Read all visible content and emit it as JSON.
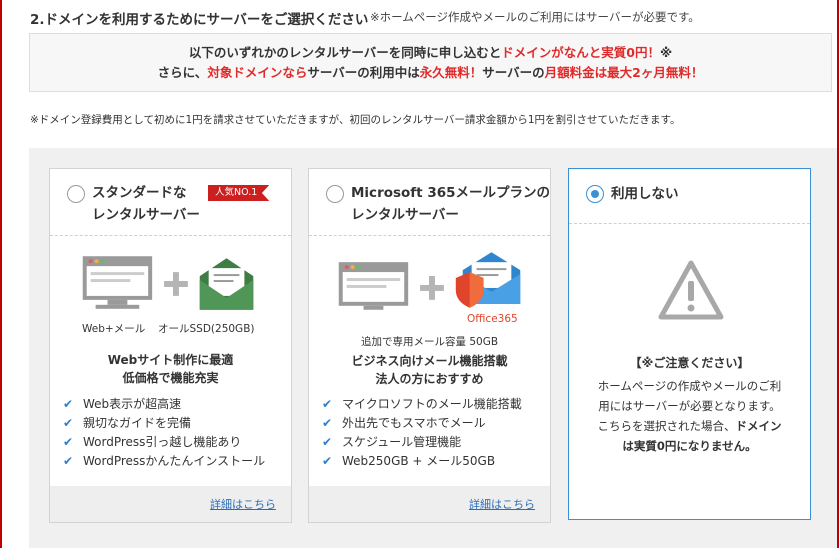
{
  "section": {
    "title": "2.ドメインを利用するためにサーバーをご選択ください",
    "note": "※ホームページ作成やメールのご利用にはサーバーが必要です。"
  },
  "notice": {
    "line1_a": "以下のいずれかのレンタルサーバーを同時に申し込むと",
    "line1_b": "ドメインがなんと実質0円！",
    "line1_c": "※",
    "line2_a": "さらに、",
    "line2_b": "対象ドメインなら",
    "line2_c": "サーバーの利用中は",
    "line2_d": "永久無料！",
    "line2_e": "サーバーの",
    "line2_f": "月額料金は最大2ヶ月無料！"
  },
  "footnote": "※ドメイン登録費用として初めに1円を請求させていただきますが、初回のレンタルサーバー請求金額から1円を割引させていただきます。",
  "cards": [
    {
      "title_line1": "スタンダードな",
      "title_line2": "レンタルサーバー",
      "badge": "人気NO.1",
      "caption_left": "Web+メール",
      "caption_right": "オールSSD(250GB)",
      "feature_line1": "Webサイト制作に最適",
      "feature_line2": "低価格で機能充実",
      "bullets": [
        "Web表示が超高速",
        "親切なガイドを完備",
        "WordPress引っ越し機能あり",
        "WordPressかんたんインストール"
      ],
      "link": "詳細はこちら",
      "selected": false
    },
    {
      "title_line1": "Microsoft 365メールプランの",
      "title_line2": "レンタルサーバー",
      "office_label": "Office365",
      "caption": "追加で専用メール容量 50GB",
      "feature_line1": "ビジネス向けメール機能搭載",
      "feature_line2": "法人の方におすすめ",
      "bullets": [
        "マイクロソフトのメール機能搭載",
        "外出先でもスマホでメール",
        "スケジュール管理機能",
        "Web250GB + メール50GB"
      ],
      "link": "詳細はこちら",
      "selected": false
    },
    {
      "title": "利用しない",
      "warn_title": "【※ご注意ください】",
      "warn_line1": "ホームページの作成やメールのご利",
      "warn_line2": "用にはサーバーが必要となります。",
      "warn_line3_a": "こちらを選択された場合、",
      "warn_line3_b": "ドメイン",
      "warn_line4": "は実質0円になりません。",
      "selected": true
    }
  ],
  "colors": {
    "accent_red": "#e02b2b",
    "badge_red": "#cc1f1f",
    "radio_blue": "#3a8fd6",
    "check_blue": "#2c7fd0",
    "envelope_green": "#3f7d46",
    "envelope_blue": "#2f86cf"
  },
  "icons": [
    "computer-icon",
    "plus-icon",
    "green-envelope-icon",
    "blue-envelope-icon",
    "shield-icon",
    "warning-triangle-icon",
    "check-icon"
  ]
}
